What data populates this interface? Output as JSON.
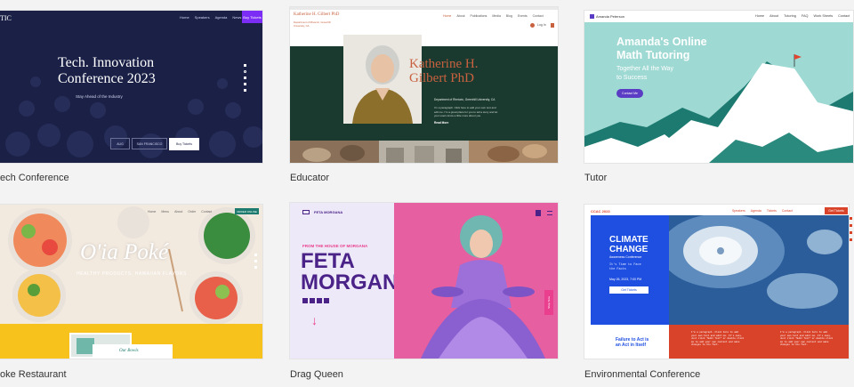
{
  "templates": [
    {
      "caption": "ech Conference",
      "logo": "TIC",
      "nav": [
        "Home",
        "Speakers",
        "Agenda",
        "News",
        "Contact"
      ],
      "cta": "Buy Tickets",
      "title_line1": "Tech. Innovation",
      "title_line2": "Conference 2023",
      "tagline": "Stay Ahead of the Industry",
      "field1": "AUG",
      "field2": "SAN FRANCISCO",
      "button": "Buy Tickets",
      "accent": "#7b2cf5"
    },
    {
      "caption": "Educator",
      "site_name": "Katherine H. Gilbert PhD",
      "nav": [
        "Home",
        "About",
        "Publications",
        "Media",
        "Blog",
        "Events",
        "Contact"
      ],
      "login": "Log In",
      "subhead_line1": "Department of Rhetoric, Greenhill University, CA",
      "name_line1": "Katherine H.",
      "name_line2": "Gilbert PhD",
      "dept": "Department of Rhetoric, Greenhill University, CA",
      "para_lines": [
        "I'm a paragraph. Click here to add your own text and",
        "edit me. I'm a great place for you to tell a story and let",
        "your users know a little more about you."
      ],
      "read_more": "Read More",
      "accent": "#c8613f",
      "panel": "#1b3a2f"
    },
    {
      "caption": "Tutor",
      "logo_name": "Amanda Peterson",
      "nav": [
        "Home",
        "About",
        "Tutoring",
        "FAQ",
        "Work Sheets",
        "Contact"
      ],
      "title_line1": "Amanda's Online",
      "title_line2": "Math Tutoring",
      "sub_line1": "Together All the Way",
      "sub_line2": "to Success",
      "button": "Contact Me",
      "accent": "#5b3cc4",
      "bg": "#9fd9d3"
    },
    {
      "caption": "oke Restaurant",
      "title": "O'ia Poké",
      "subtitle": "HEALTHY PRODUCTS, HAWAIIAN FLAVORS",
      "nav": [
        "Home",
        "Menu",
        "About",
        "Order",
        "Contact"
      ],
      "cta": "ORDER ONLINE",
      "card_text": "Our Bowls",
      "accent": "#f7c21b"
    },
    {
      "caption": "Drag Queen",
      "logo": "FETA MORGANA",
      "kicker": "FROM THE HOUSE OF MORGANA",
      "name_line1": "FETA",
      "name_line2": "MORGANA",
      "side_tab": "Shop Now",
      "arrow": "↓",
      "accent": "#ea3f8e",
      "purple": "#4a2288"
    },
    {
      "caption": "Environmental Conference",
      "logo": "CCAC 2023",
      "nav": [
        "Speakers",
        "Agenda",
        "Tickets",
        "Contact"
      ],
      "cta": "Get Tickets",
      "title_line1": "CLIMATE",
      "title_line2": "CHANGE",
      "subtitle": "Awareness Conference",
      "tagline_line1": "It's Time to Face",
      "tagline_line2": "the Facts",
      "date": "May 26, 2023, 7:00 PM",
      "button": "Get Tickets",
      "footer_line1": "Failure to Act is",
      "footer_line2": "an Act in Itself",
      "para_lines": [
        "I'm a paragraph. Click here to add",
        "your own text and edit me. It's easy.",
        "Just click \"Edit Text\" or double click",
        "me to add your own content and make",
        "changes to the font."
      ],
      "blue": "#1f4fe0",
      "red": "#d9432a"
    }
  ]
}
